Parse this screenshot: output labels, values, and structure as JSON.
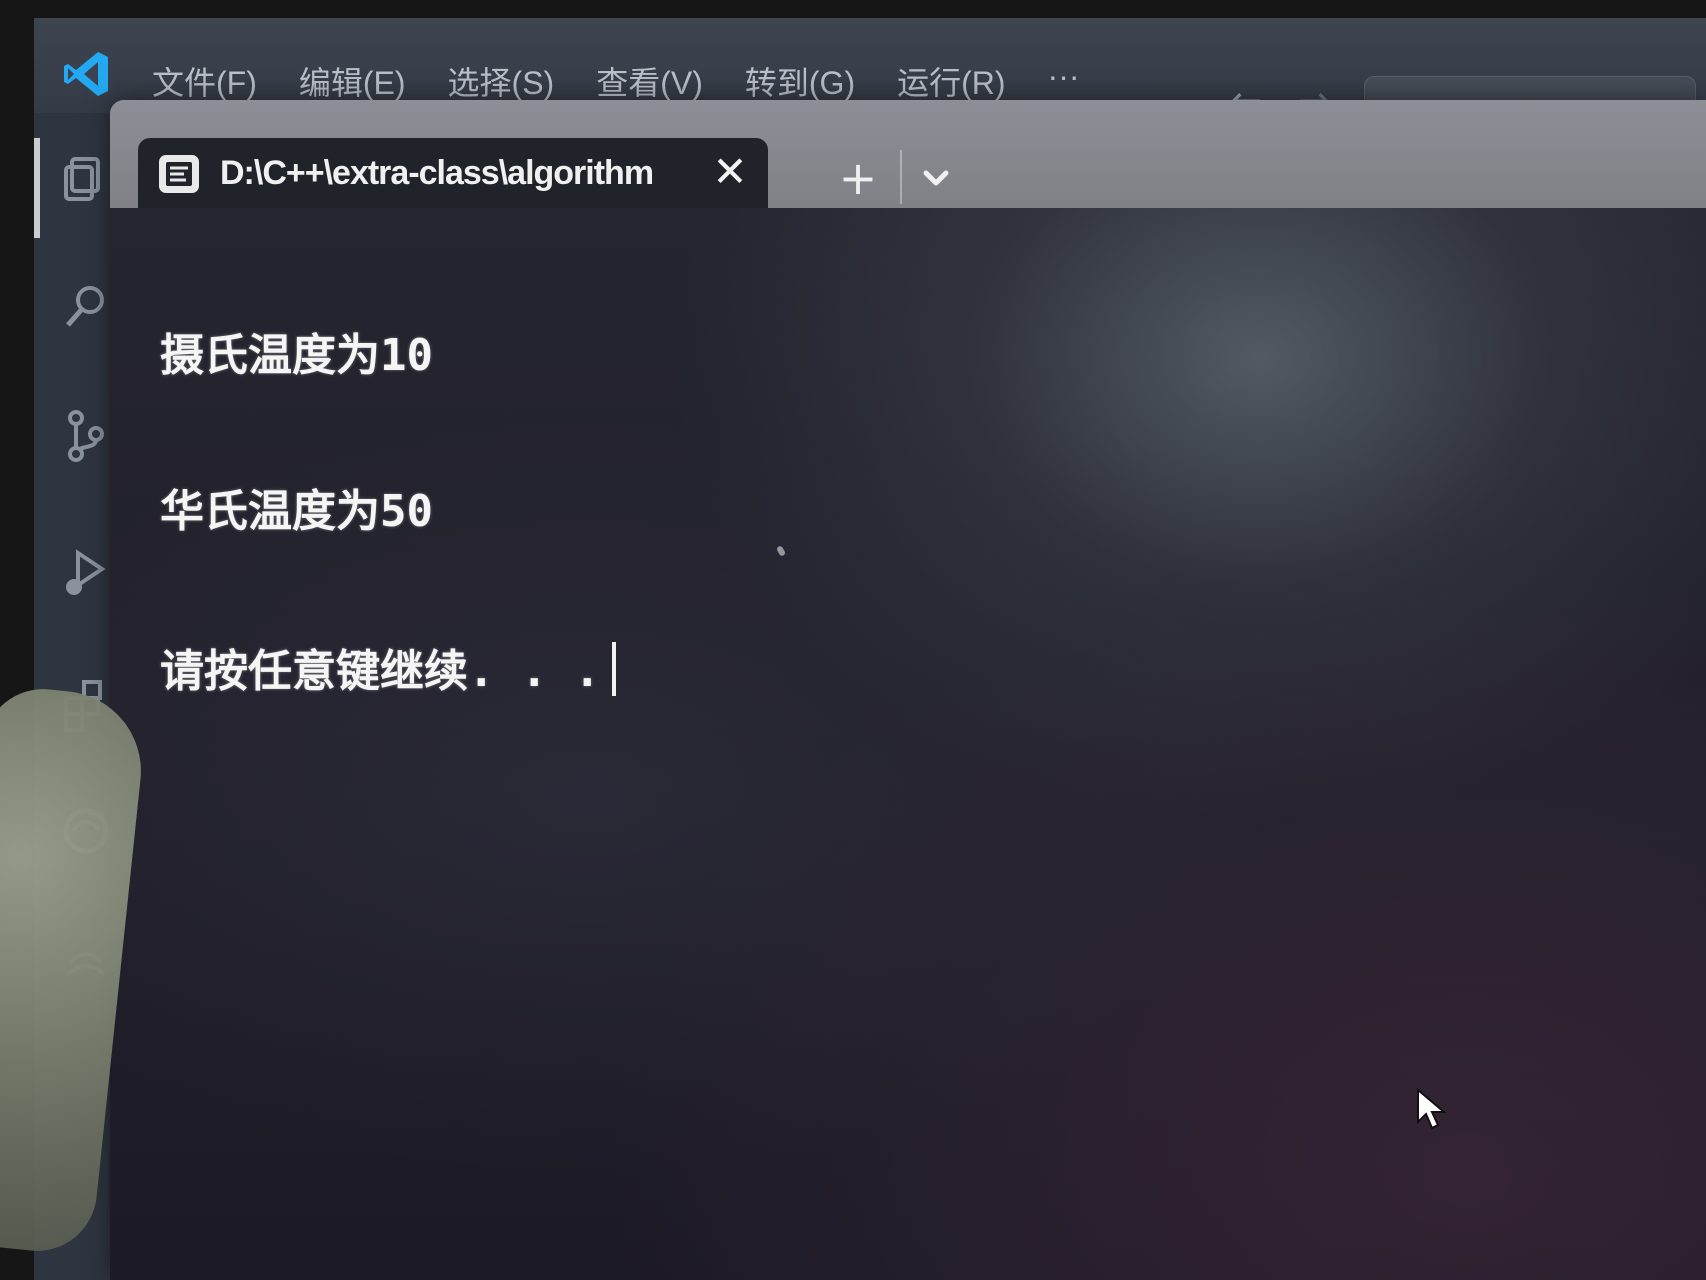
{
  "menu": {
    "items": [
      "文件(F)",
      "编辑(E)",
      "选择(S)",
      "查看(V)",
      "转到(G)",
      "运行(R)",
      "···"
    ]
  },
  "navigation": {
    "back_icon": "arrow-left-icon",
    "forward_icon": "arrow-right-icon"
  },
  "activity_bar": {
    "icons": [
      "explorer-icon",
      "search-icon",
      "source-control-icon",
      "run-debug-icon",
      "extensions-icon",
      "remote-icon",
      "account-icon"
    ]
  },
  "terminal": {
    "tab_title": "D:\\C++\\extra-class\\algorithm",
    "tab_close_icon": "close-icon",
    "new_tab_icon": "plus-icon",
    "dropdown_icon": "chevron-down-icon",
    "output": [
      "摄氏温度为10",
      "华氏温度为50",
      "请按任意键继续. . ."
    ]
  },
  "colors": {
    "terminal_background": "#1c1a26",
    "terminal_text": "#f5f5f5",
    "tab_background": "#202329",
    "tabbar_background": "#8c8f95",
    "vscode_accent": "#23a9f2"
  }
}
